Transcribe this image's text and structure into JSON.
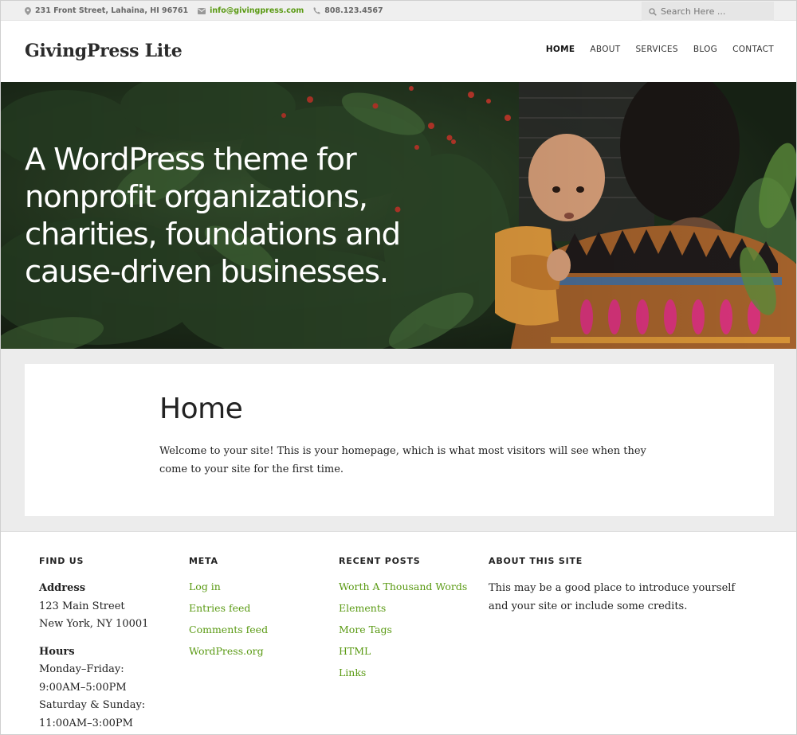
{
  "topbar": {
    "address": "231 Front Street, Lahaina, HI 96761",
    "email": "info@givingpress.com",
    "phone": "808.123.4567",
    "search_placeholder": "Search Here ...",
    "icons": [
      "location-pin-icon",
      "envelope-icon",
      "phone-icon",
      "search-icon"
    ]
  },
  "header": {
    "site_title": "GivingPress Lite",
    "nav": [
      {
        "label": "HOME",
        "active": true
      },
      {
        "label": "ABOUT"
      },
      {
        "label": "SERVICES"
      },
      {
        "label": "BLOG"
      },
      {
        "label": "CONTACT"
      }
    ]
  },
  "hero": {
    "headline": "A WordPress theme for nonprofit organizations, charities, foundations and cause-driven businesses."
  },
  "main": {
    "page_title": "Home",
    "body": "Welcome to your site! This is your homepage, which is what most visitors will see when they come to your site for the first time."
  },
  "footer": {
    "find_us": {
      "heading": "FIND US",
      "address_label": "Address",
      "address_line1": "123 Main Street",
      "address_line2": "New York, NY 10001",
      "hours_label": "Hours",
      "hours": [
        "Monday–Friday:",
        "9:00AM–5:00PM",
        "Saturday & Sunday:",
        "11:00AM–3:00PM"
      ]
    },
    "meta": {
      "heading": "META",
      "links": [
        "Log in",
        "Entries feed",
        "Comments feed",
        "WordPress.org"
      ]
    },
    "recent_posts": {
      "heading": "RECENT POSTS",
      "links": [
        "Worth A Thousand Words",
        "Elements",
        "More Tags",
        "HTML",
        "Links"
      ]
    },
    "about": {
      "heading": "ABOUT THIS SITE",
      "text": "This may be a good place to introduce yourself and your site or include some credits."
    }
  },
  "colors": {
    "accent_green": "#5a9a13",
    "topbar_bg": "#efefef",
    "content_bg": "#ececec"
  }
}
